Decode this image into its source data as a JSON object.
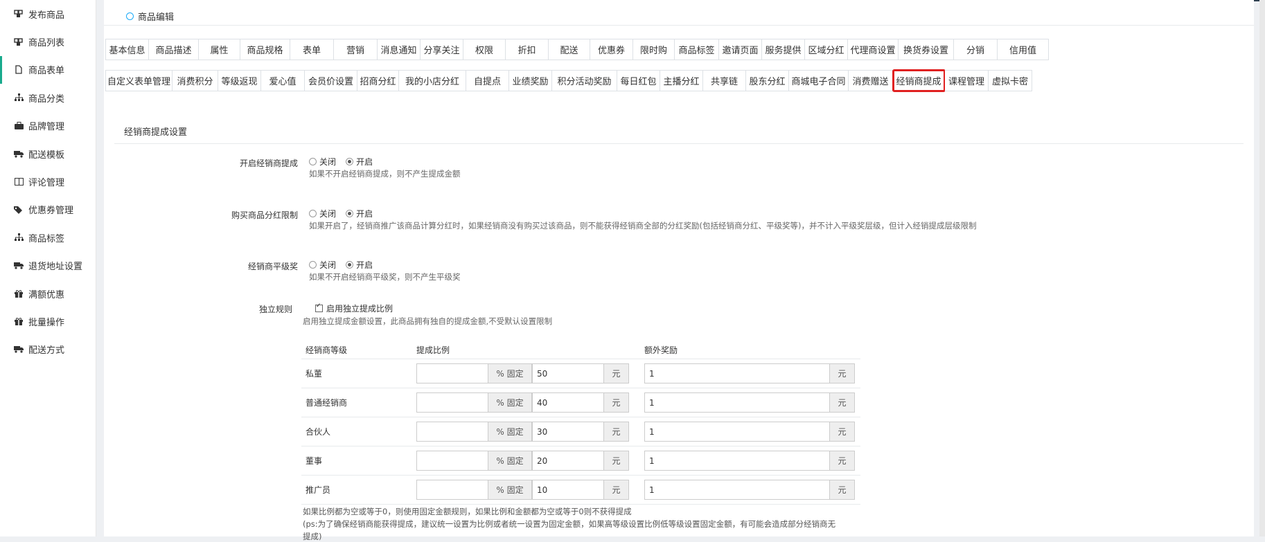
{
  "sidebar": {
    "items": [
      {
        "label": "发布商品",
        "icon": "cubes-icon"
      },
      {
        "label": "商品列表",
        "icon": "cubes-icon"
      },
      {
        "label": "商品表单",
        "icon": "file-icon"
      },
      {
        "label": "商品分类",
        "icon": "sitemap-icon"
      },
      {
        "label": "品牌管理",
        "icon": "briefcase-icon"
      },
      {
        "label": "配送模板",
        "icon": "truck-icon"
      },
      {
        "label": "评论管理",
        "icon": "book-icon"
      },
      {
        "label": "优惠券管理",
        "icon": "tags-icon"
      },
      {
        "label": "商品标签",
        "icon": "sitemap-icon"
      },
      {
        "label": "退货地址设置",
        "icon": "truck-icon"
      },
      {
        "label": "满额优惠",
        "icon": "gift-icon"
      },
      {
        "label": "批量操作",
        "icon": "gift-icon"
      },
      {
        "label": "配送方式",
        "icon": "truck-icon"
      }
    ]
  },
  "breadcrumb": "商品编辑",
  "tabs_row1": [
    "基本信息",
    "商品描述",
    "属性",
    "商品规格",
    "表单",
    "营销",
    "消息通知",
    "分享关注",
    "权限",
    "折扣",
    "配送",
    "优惠券",
    "限时购",
    "商品标签",
    "邀请页面",
    "服务提供",
    "区域分红",
    "代理商设置",
    "换货券设置",
    "分销",
    "信用值"
  ],
  "tabs_row2": [
    "自定义表单管理",
    "消费积分",
    "等级返现",
    "爱心值",
    "会员价设置",
    "招商分红",
    "我的小店分红",
    "自提点",
    "业绩奖励",
    "积分活动奖励",
    "每日红包",
    "主播分红",
    "共享链",
    "股东分红",
    "商城电子合同",
    "消费赠送",
    "经销商提成",
    "课程管理",
    "虚拟卡密"
  ],
  "section_title": "经销商提成设置",
  "options": {
    "off": "关闭",
    "on": "开启"
  },
  "fields": {
    "enable": {
      "label": "开启经销商提成",
      "help": "如果不开启经销商提成，则不产生提成金额"
    },
    "limit": {
      "label": "购买商品分红限制",
      "help": "如果开启了，经销商推广该商品计算分红时，如果经销商没有购买过该商品，则不能获得经销商全部的分红奖励(包括经销商分红、平级奖等)，并不计入平级奖层级，但计入经销提成层级限制"
    },
    "peer": {
      "label": "经销商平级奖",
      "help": "如果不开启经销商平级奖，则不产生平级奖"
    },
    "independent": {
      "label": "独立规则",
      "checkbox": "启用独立提成比例",
      "help": "启用独立提成金额设置，此商品拥有独自的提成金额,不受默认设置限制"
    }
  },
  "table": {
    "headers": [
      "经销商等级",
      "提成比例",
      "额外奖励"
    ],
    "pct_addon": "% 固定",
    "unit": "元",
    "rows": [
      {
        "level": "私董",
        "ratio": "",
        "fixed": "50",
        "extra": "1"
      },
      {
        "level": "普通经销商",
        "ratio": "",
        "fixed": "40",
        "extra": "1"
      },
      {
        "level": "合伙人",
        "ratio": "",
        "fixed": "30",
        "extra": "1"
      },
      {
        "level": "董事",
        "ratio": "",
        "fixed": "20",
        "extra": "1"
      },
      {
        "level": "推广员",
        "ratio": "",
        "fixed": "10",
        "extra": "1"
      }
    ]
  },
  "notes": [
    "如果比例都为空或等于0，则使用固定金额规则，如果比例和金额都为空或等于0则不获得提成",
    "(ps:为了确保经销商能获得提成，建议统一设置为比例或者统一设置为固定金额，如果高等级设置比例低等级设置固定金额，有可能会造成部分经销商无",
    "提成)"
  ]
}
